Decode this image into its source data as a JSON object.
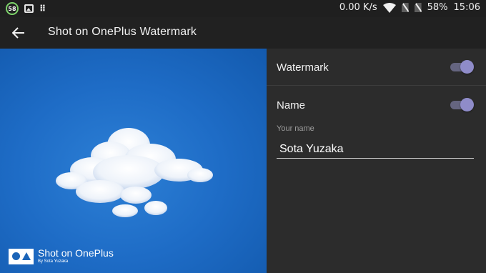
{
  "status_bar": {
    "notification_badge": "58",
    "net_speed": "0.00 K/s",
    "battery": "58%",
    "time": "15:06"
  },
  "app_bar": {
    "title": "Shot on OnePlus Watermark"
  },
  "preview": {
    "watermark_title": "Shot on OnePlus",
    "watermark_byline": "By Sota Yuzaka"
  },
  "settings": {
    "watermark_label": "Watermark",
    "watermark_enabled": true,
    "name_label": "Name",
    "name_enabled": true,
    "your_name_label": "Your name",
    "your_name_value": "Sota Yuzaka"
  },
  "colors": {
    "accent": "#8f8cc9",
    "panel_bg": "#2c2c2c",
    "appbar_bg": "#212121",
    "sky": "#1e6cc6"
  }
}
